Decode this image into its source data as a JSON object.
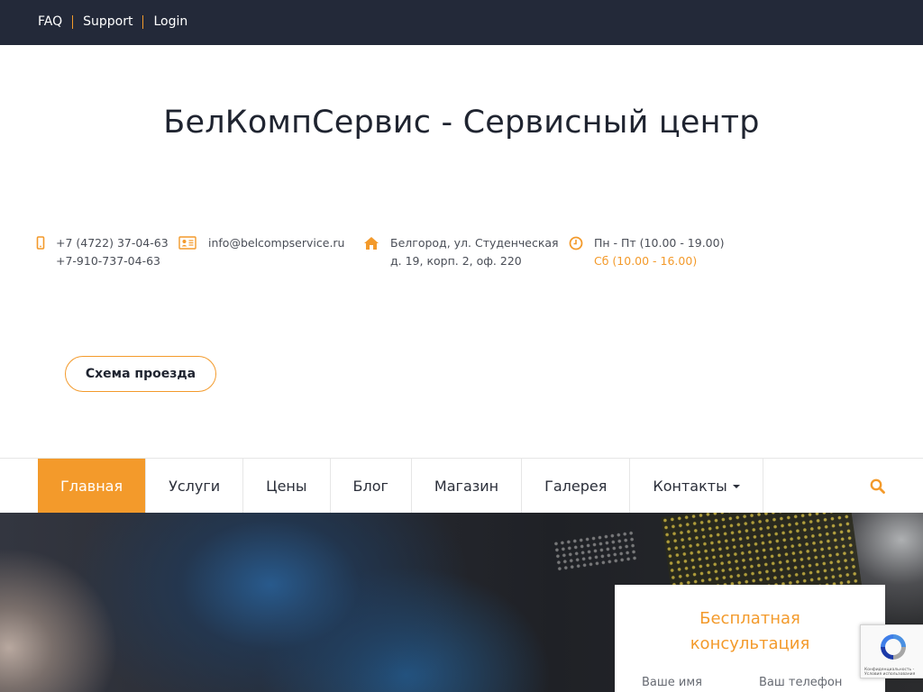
{
  "topbar": {
    "links": [
      "FAQ",
      "Support",
      "Login"
    ]
  },
  "header": {
    "title": "БелКомпСервис - Сервисный центр"
  },
  "contacts": {
    "phone": {
      "line1": "+7 (4722) 37-04-63",
      "line2": "+7-910-737-04-63",
      "icon": "mobile-phone-icon"
    },
    "email": {
      "line1": "info@belcompservice.ru",
      "icon": "contact-card-icon"
    },
    "address": {
      "line1": "Белгород, ул. Студенческая",
      "line2": "д. 19, корп. 2, оф. 220",
      "icon": "home-icon"
    },
    "hours": {
      "line1": "Пн - Пт (10.00 - 19.00)",
      "line2": "Сб (10.00 - 16.00)",
      "icon": "clock-icon"
    }
  },
  "route_button": {
    "label": "Схема проезда"
  },
  "nav": {
    "items": [
      {
        "label": "Главная",
        "active": true
      },
      {
        "label": "Услуги",
        "active": false
      },
      {
        "label": "Цены",
        "active": false
      },
      {
        "label": "Блог",
        "active": false
      },
      {
        "label": "Магазин",
        "active": false
      },
      {
        "label": "Галерея",
        "active": false
      },
      {
        "label": "Контакты",
        "active": false,
        "dropdown": true
      }
    ],
    "search_icon": "search-icon"
  },
  "consult": {
    "title_line1": "Бесплатная",
    "title_line2": "консультация",
    "name_placeholder": "Ваше имя",
    "phone_placeholder": "Ваш телефон"
  },
  "recaptcha": {
    "terms": "Конфиденциальность - Условия использования"
  },
  "colors": {
    "accent": "#f39a2b",
    "topbar": "#232939",
    "text": "#2b2f3a"
  }
}
